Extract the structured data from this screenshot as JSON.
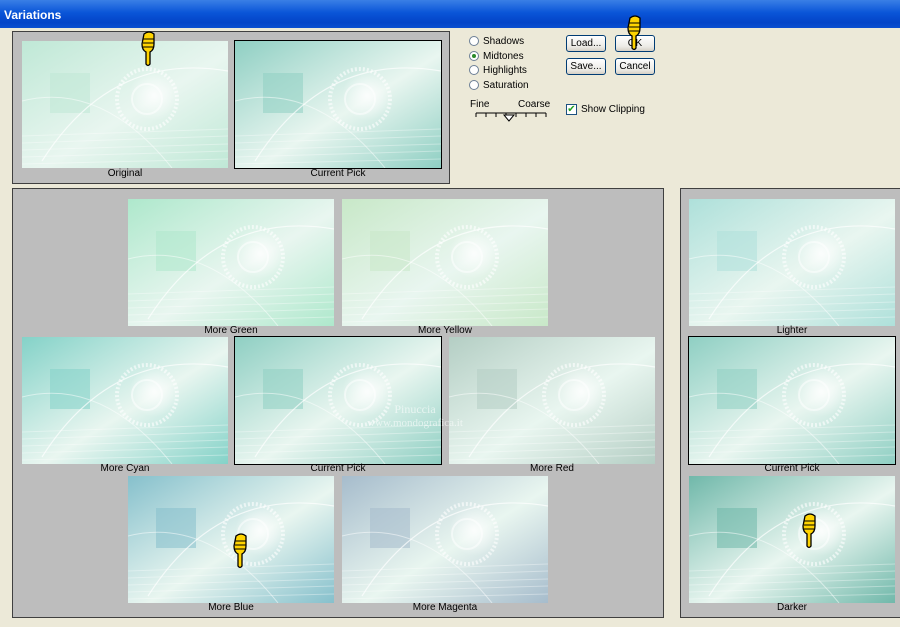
{
  "window": {
    "title": "Variations"
  },
  "top": {
    "original": {
      "label": "Original"
    },
    "current": {
      "label": "Current Pick"
    }
  },
  "tone_options": [
    {
      "label": "Shadows",
      "selected": false
    },
    {
      "label": "Midtones",
      "selected": true
    },
    {
      "label": "Highlights",
      "selected": false
    },
    {
      "label": "Saturation",
      "selected": false
    }
  ],
  "slider": {
    "fine_label": "Fine",
    "coarse_label": "Coarse"
  },
  "buttons": {
    "load": "Load...",
    "save": "Save...",
    "ok": "OK",
    "cancel": "Cancel"
  },
  "show_clipping": {
    "label": "Show Clipping",
    "checked": true
  },
  "color_variations": {
    "more_green": "More Green",
    "more_yellow": "More Yellow",
    "more_cyan": "More Cyan",
    "current_pick": "Current Pick",
    "more_red": "More Red",
    "more_blue": "More Blue",
    "more_magenta": "More Magenta"
  },
  "brightness": {
    "lighter": "Lighter",
    "current_pick": "Current Pick",
    "darker": "Darker"
  },
  "watermark": {
    "line1": "Pinuccia",
    "line2": "www.mondografica.it"
  },
  "colors": {
    "titlebar": "#0a55d8",
    "dialog_bg": "#ece9d8",
    "panel_bg": "#bdbdbd",
    "original_tint": "#bfe8d6",
    "current_tint": "#8fcfc3",
    "green_tint": "#aee8cc",
    "yellow_tint": "#c8e8c8",
    "cyan_tint": "#84d2c8",
    "red_tint": "#b4cec4",
    "blue_tint": "#86c0cc",
    "magenta_tint": "#a6bccc",
    "lighter_tint": "#aee0da",
    "darker_tint": "#70b8aa",
    "hand_pointer": "#ffd400"
  }
}
